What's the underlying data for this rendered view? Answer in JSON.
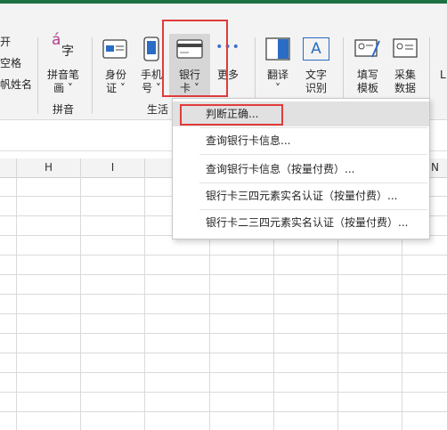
{
  "ribbon": {
    "left_partial": [
      "开",
      "空格",
      "帆姓名"
    ],
    "pinyin": {
      "label_line1": "拼音笔",
      "label_line2": "画 ˅",
      "group": "拼音",
      "glyph_top": "á",
      "glyph_bottom": "字"
    },
    "shenfen": {
      "label_line1": "身份",
      "label_line2": "证 ˅"
    },
    "shouji": {
      "label_line1": "手机",
      "label_line2": "号 ˅"
    },
    "yinhang": {
      "label_line1": "银行",
      "label_line2": "卡 ˅"
    },
    "gengduo": {
      "label_line1": "更多",
      "dots": "•••"
    },
    "group_life": "生活",
    "fanyi": {
      "label_line1": "翻译",
      "label_line2": "˅"
    },
    "wenzi": {
      "label_line1": "文字",
      "label_line2": "识别",
      "glyph": "A"
    },
    "tianxie": {
      "label_line1": "填写",
      "label_line2": "模板"
    },
    "caiji": {
      "label_line1": "采集",
      "label_line2": "数据"
    },
    "right_partial": "L"
  },
  "columns": [
    "H",
    "I",
    "N"
  ],
  "menu": {
    "items": [
      "判断正确...",
      "查询银行卡信息...",
      "查询银行卡信息（按量付费）...",
      "银行卡三四元素实名认证（按量付费）...",
      "银行卡二三四元素实名认证（按量付费）..."
    ]
  },
  "colors": {
    "accent": "#1e7145",
    "highlight": "#e03b3b",
    "icon_blue": "#2b6cc4"
  }
}
